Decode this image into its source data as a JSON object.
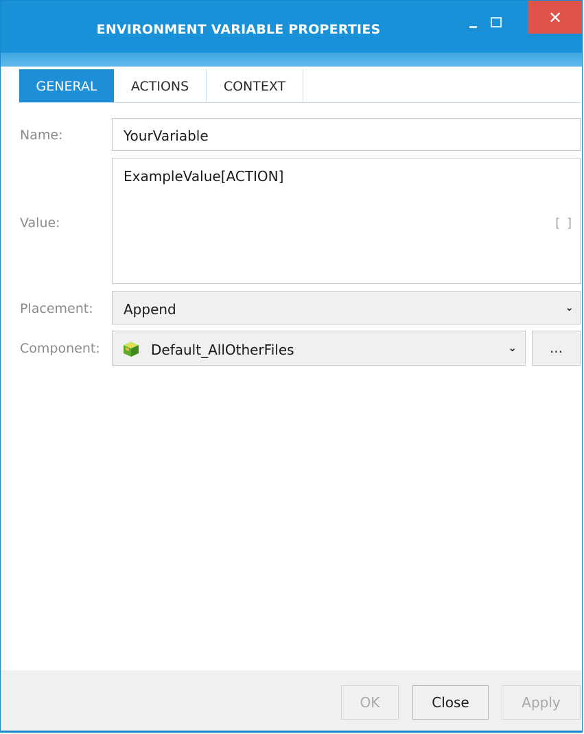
{
  "window": {
    "title": "ENVIRONMENT VARIABLE PROPERTIES",
    "close_glyph": "✕"
  },
  "tabs": [
    {
      "label": "GENERAL",
      "active": true
    },
    {
      "label": "ACTIONS",
      "active": false
    },
    {
      "label": "CONTEXT",
      "active": false
    }
  ],
  "form": {
    "name_label": "Name:",
    "name_value": "YourVariable",
    "value_label": "Value:",
    "value_text": "ExampleValue[ACTION]",
    "value_brackets": "[ ]",
    "placement_label": "Placement:",
    "placement_value": "Append",
    "component_label": "Component:",
    "component_value": "Default_AllOtherFiles",
    "component_icon": "component-cube-icon",
    "browse_label": "..."
  },
  "footer": {
    "ok_label": "OK",
    "close_label": "Close",
    "apply_label": "Apply"
  },
  "colors": {
    "titlebar": "#1991d8",
    "active_tab": "#1e8fd7",
    "close_button": "#e0524a"
  }
}
